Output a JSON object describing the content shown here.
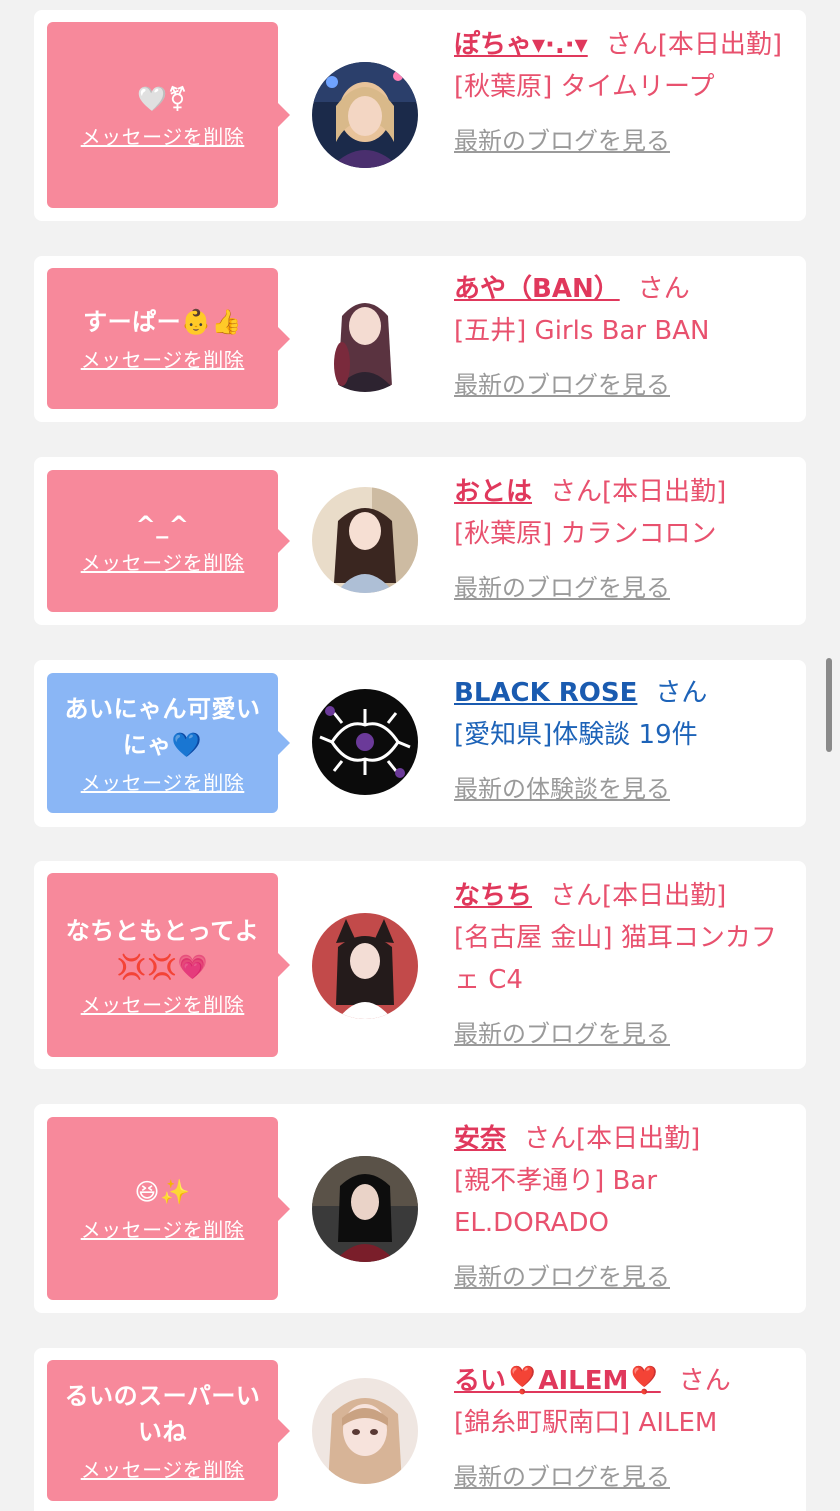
{
  "delete_label": "メッセージを削除",
  "items": [
    {
      "message": "🤍⚧",
      "name": "ぽちゃ▾·.·▾",
      "san": "さん",
      "status": "[本日出勤]",
      "shop": "[秋葉原] タイムリープ",
      "blog_link": "最新のブログを見る",
      "bubble_color": "#f7899b"
    },
    {
      "message": "すーぱー👶👍",
      "name": "あや（BAN）",
      "san": "さん",
      "status": "",
      "shop": "[五井] Girls Bar BAN",
      "blog_link": "最新のブログを見る",
      "bubble_color": "#f7899b"
    },
    {
      "message": "^_^",
      "name": "おとは",
      "san": "さん",
      "status": "[本日出勤]",
      "shop": "[秋葉原] カランコロン",
      "blog_link": "最新のブログを見る",
      "bubble_color": "#f7899b"
    },
    {
      "message": "あいにゃん可愛いにゃ💙",
      "name": "BLACK ROSE",
      "san": "さん",
      "status": "",
      "shop": "[愛知県]体験談 19件",
      "blog_link": "最新の体験談を見る",
      "bubble_color": "#8ab6f5"
    },
    {
      "message": "なちともとってよ💢💢💗",
      "name": "なちち",
      "san": "さん",
      "status": "[本日出勤]",
      "shop": "[名古屋 金山] 猫耳コンカフェ C4",
      "blog_link": "最新のブログを見る",
      "bubble_color": "#f7899b"
    },
    {
      "message": "😆✨",
      "name": "安奈",
      "san": "さん",
      "status": "[本日出勤]",
      "shop": "[親不孝通り] Bar EL.DORADO",
      "blog_link": "最新のブログを見る",
      "bubble_color": "#f7899b"
    },
    {
      "message": "るいのスーパーいいね",
      "name": "るい❣️AILEM❣️",
      "san": "さん",
      "status": "",
      "shop": "[錦糸町駅南口] AILEM",
      "blog_link": "最新のブログを見る",
      "bubble_color": "#f7899b"
    }
  ],
  "icons": [
    "white-heart-icon",
    "gender-icon",
    "baby-icon",
    "thumbs-up-icon",
    "blue-heart-icon",
    "anger-icon",
    "pink-heart-icon",
    "laughing-face-icon",
    "sparkles-icon",
    "heart-exclamation-icon"
  ]
}
